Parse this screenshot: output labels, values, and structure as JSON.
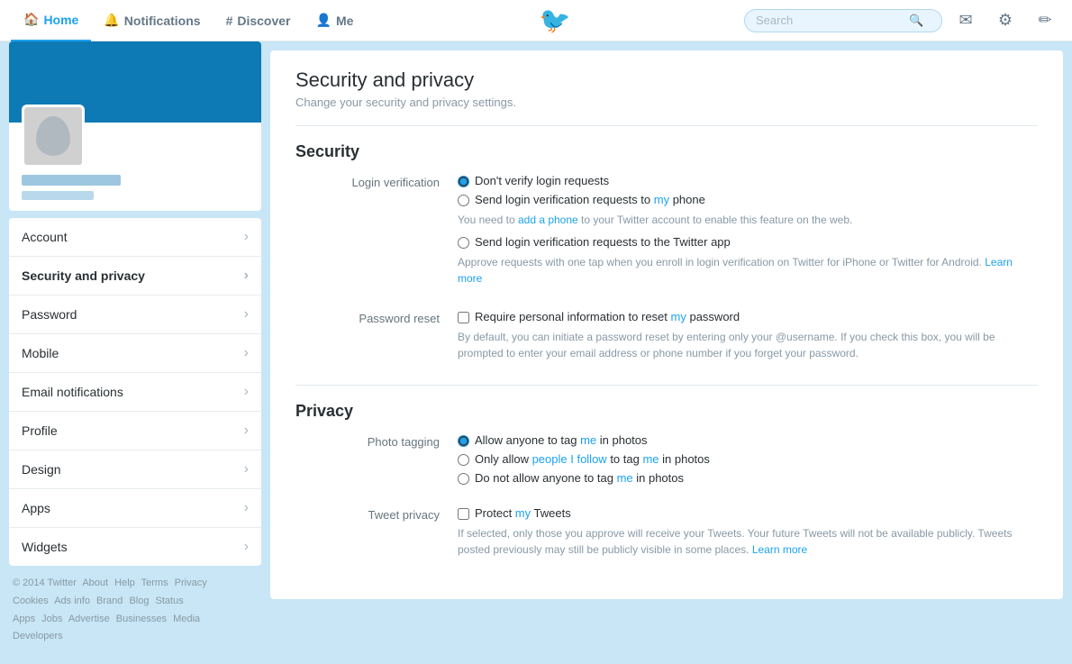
{
  "nav": {
    "items": [
      {
        "label": "Home",
        "icon": "🏠",
        "active": true,
        "name": "home"
      },
      {
        "label": "Notifications",
        "icon": "🔔",
        "active": false,
        "name": "notifications"
      },
      {
        "label": "Discover",
        "icon": "#",
        "active": false,
        "name": "discover"
      },
      {
        "label": "Me",
        "icon": "👤",
        "active": false,
        "name": "me"
      }
    ],
    "search_placeholder": "Search",
    "twitter_logo": "🐦"
  },
  "sidebar": {
    "profile": {
      "name_placeholder": "",
      "handle_placeholder": ""
    },
    "menu": [
      {
        "label": "Account",
        "active": false
      },
      {
        "label": "Security and privacy",
        "active": true
      },
      {
        "label": "Password",
        "active": false
      },
      {
        "label": "Mobile",
        "active": false
      },
      {
        "label": "Email notifications",
        "active": false
      },
      {
        "label": "Profile",
        "active": false
      },
      {
        "label": "Design",
        "active": false
      },
      {
        "label": "Apps",
        "active": false
      },
      {
        "label": "Widgets",
        "active": false
      }
    ],
    "footer": {
      "links": [
        "© 2014 Twitter",
        "About",
        "Help",
        "Terms",
        "Privacy",
        "Cookies",
        "Ads info",
        "Brand",
        "Blog",
        "Status",
        "Apps",
        "Jobs",
        "Advertise",
        "Businesses",
        "Media",
        "Developers"
      ]
    }
  },
  "settings": {
    "title": "Security and privacy",
    "subtitle": "Change your security and privacy settings.",
    "sections": [
      {
        "heading": "Security",
        "rows": [
          {
            "label": "Login verification",
            "type": "radio-group",
            "options": [
              {
                "text": "Don't verify login requests",
                "checked": true,
                "hint": null
              },
              {
                "text": "Send login verification requests to my phone",
                "checked": false,
                "hint": "You need to add a phone to your Twitter account to enable this feature on the web.",
                "hint_link_text": "add a phone",
                "hint_link_placeholder": true
              },
              {
                "text": "Send login verification requests to the Twitter app",
                "checked": false,
                "hint": "Approve requests with one tap when you enroll in login verification on Twitter for iPhone or Twitter for Android. Learn more",
                "hint_link_text": "Learn more"
              }
            ]
          },
          {
            "label": "Password reset",
            "type": "checkbox-group",
            "options": [
              {
                "text": "Require personal information to reset my password",
                "checked": false,
                "hint": "By default, you can initiate a password reset by entering only your @username. If you check this box, you will be prompted to enter your email address or phone number if you forget your password."
              }
            ]
          }
        ]
      },
      {
        "heading": "Privacy",
        "rows": [
          {
            "label": "Photo tagging",
            "type": "radio-group",
            "options": [
              {
                "text": "Allow anyone to tag me in photos",
                "checked": true,
                "hint": null
              },
              {
                "text": "Only allow people I follow to tag me in photos",
                "checked": false,
                "hint": null
              },
              {
                "text": "Do not allow anyone to tag me in photos",
                "checked": false,
                "hint": null
              }
            ]
          },
          {
            "label": "Tweet privacy",
            "type": "checkbox-group",
            "options": [
              {
                "text": "Protect my Tweets",
                "checked": false,
                "hint": "If selected, only those you approve will receive your Tweets. Your future Tweets will not be available publicly. Tweets posted previously may still be publicly visible in some places. Learn more"
              }
            ]
          }
        ]
      }
    ]
  }
}
